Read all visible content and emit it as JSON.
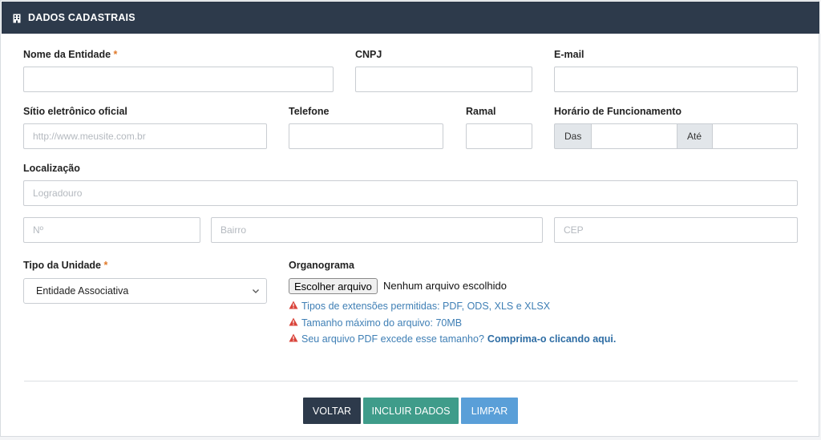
{
  "header": {
    "title": "DADOS CADASTRAIS",
    "icon": "building-icon"
  },
  "fields": {
    "nome_entidade": {
      "label": "Nome da Entidade",
      "required_mark": "*",
      "value": ""
    },
    "cnpj": {
      "label": "CNPJ",
      "value": ""
    },
    "email": {
      "label": "E-mail",
      "value": ""
    },
    "sitio": {
      "label": "Sítio eletrônico oficial",
      "placeholder": "http://www.meusite.com.br"
    },
    "telefone": {
      "label": "Telefone",
      "value": ""
    },
    "ramal": {
      "label": "Ramal",
      "value": ""
    },
    "horario": {
      "label": "Horário de Funcionamento",
      "das": "Das",
      "ate": "Até"
    },
    "localizacao": {
      "label": "Localização",
      "logradouro_placeholder": "Logradouro",
      "numero_placeholder": "Nº",
      "bairro_placeholder": "Bairro",
      "cep_placeholder": "CEP"
    },
    "tipo_unidade": {
      "label": "Tipo da Unidade",
      "required_mark": "*",
      "selected": "Entidade Associativa"
    },
    "organograma": {
      "label": "Organograma",
      "button_label": "Escolher arquivo",
      "file_status": "Nenhum arquivo escolhido",
      "notes": [
        "Tipos de extensões permitidas: PDF, ODS, XLS e XLSX",
        "Tamanho máximo do arquivo: 70MB",
        "Seu arquivo PDF excede esse tamanho?"
      ],
      "compress_link": "Comprima-o clicando aqui."
    }
  },
  "actions": {
    "voltar": "VOLTAR",
    "incluir": "INCLUIR DADOS",
    "limpar": "LIMPAR"
  },
  "colors": {
    "header_bg": "#2d3a4b",
    "required": "#e07a2b",
    "voltar": "#2d3a4b",
    "incluir": "#3f9c8a",
    "limpar": "#5a9fd8",
    "note_text": "#3f7fb5",
    "warning": "#d9433a"
  }
}
